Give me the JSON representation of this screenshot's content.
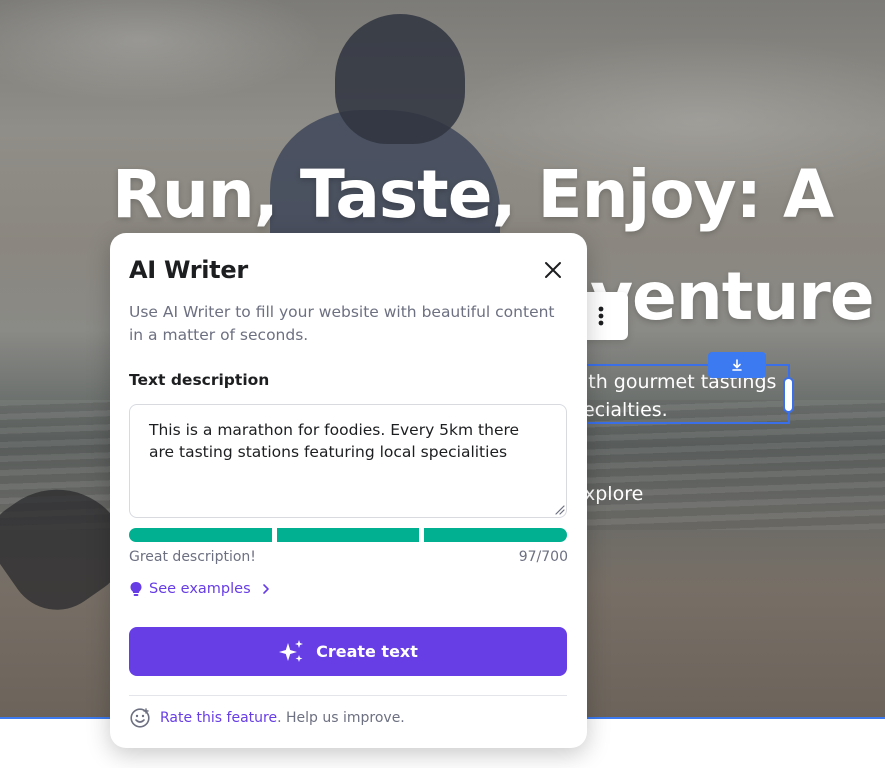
{
  "hero": {
    "title_line1": "Run, Taste, Enjoy: A",
    "title_line2": "venture",
    "subtitle_line1": "ith gourmet tastings",
    "subtitle_line2": "ecialties.",
    "cta": "xplore"
  },
  "dialog": {
    "title": "AI Writer",
    "description": "Use AI Writer to fill your website with beautiful content in a matter of seconds.",
    "field_label": "Text description",
    "textarea_value": "This is a marathon for foodies. Every 5km there are tasting stations featuring local specialities",
    "meter_segments_filled": 3,
    "meter_segments_total": 3,
    "quality_text": "Great description!",
    "char_count": "97/700",
    "see_examples": "See examples",
    "create_button": "Create text",
    "rate_link": "Rate this feature",
    "rate_rest": ". Help us improve."
  },
  "colors": {
    "accent": "#673de6",
    "meter": "#00b090",
    "selection": "#3b7af0"
  }
}
